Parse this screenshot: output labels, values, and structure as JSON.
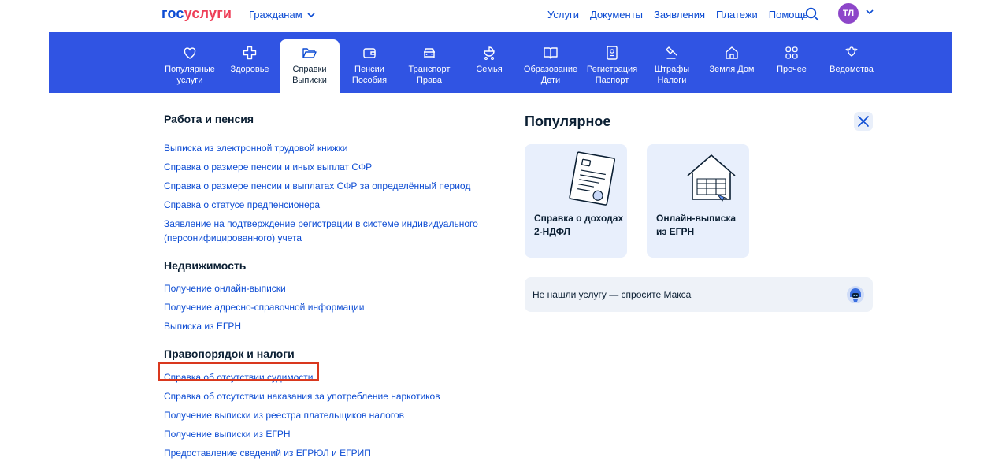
{
  "header": {
    "logo_part1": "гос",
    "logo_part2": "услуги",
    "audience": "Гражданам",
    "nav": [
      "Услуги",
      "Документы",
      "Заявления",
      "Платежи",
      "Помощь"
    ],
    "avatar_initials": "ТЛ",
    "icons": {
      "search": "search-icon",
      "chevron": "chevron-down-icon"
    }
  },
  "categories": [
    {
      "label": "Популярные\nуслуги",
      "icon": "heart-icon"
    },
    {
      "label": "Здоровье",
      "icon": "cross-icon"
    },
    {
      "label": "Справки\nВыписки",
      "icon": "folder-icon",
      "active": true
    },
    {
      "label": "Пенсии\nПособия",
      "icon": "wallet-icon"
    },
    {
      "label": "Транспорт\nПрава",
      "icon": "car-icon"
    },
    {
      "label": "Семья",
      "icon": "stroller-icon"
    },
    {
      "label": "Образование\nДети",
      "icon": "book-icon"
    },
    {
      "label": "Регистрация\nПаспорт",
      "icon": "passport-icon"
    },
    {
      "label": "Штрафы\nНалоги",
      "icon": "gavel-icon"
    },
    {
      "label": "Земля Дом",
      "icon": "house-icon"
    },
    {
      "label": "Прочее",
      "icon": "grid-icon"
    },
    {
      "label": "Ведомства",
      "icon": "emblem-icon"
    }
  ],
  "sections": [
    {
      "title": "Работа и пенсия",
      "links": [
        "Выписка из электронной трудовой книжки",
        "Справка о размере пенсии и иных выплат СФР",
        "Справка о размере пенсии и выплатах СФР за определённый период",
        "Справка о статусе предпенсионера",
        "Заявление на подтверждение регистрации в системе индивидуального",
        "(персонифицированного) учета"
      ]
    },
    {
      "title": "Недвижимость",
      "links": [
        "Получение онлайн-выписки",
        "Получение адресно-справочной информации",
        "Выписка из ЕГРН"
      ]
    },
    {
      "title": "Правопорядок и налоги",
      "links": [
        "Справка об отсутствии судимости",
        "Справка об отсутствии наказания за употребление наркотиков",
        "Получение выписки из реестра плательщиков налогов",
        "Получение выписки из ЕГРН",
        "Предоставление сведений из ЕГРЮЛ и ЕГРИП"
      ]
    }
  ],
  "popular": {
    "title": "Популярное",
    "cards": [
      {
        "title": "Справка о доходах\n2-НДФЛ",
        "icon": "document-icon"
      },
      {
        "title": "Онлайн-выписка\nиз ЕГРН",
        "icon": "house-document-icon"
      }
    ],
    "ask": "Не нашли услугу — спросите Макса",
    "close_icon": "close-icon",
    "bot_icon": "robot-icon"
  },
  "colors": {
    "accent": "#0d4cd3",
    "band": "#3054e3",
    "highlight": "#d9381e",
    "avatar": "#8d46c9"
  }
}
